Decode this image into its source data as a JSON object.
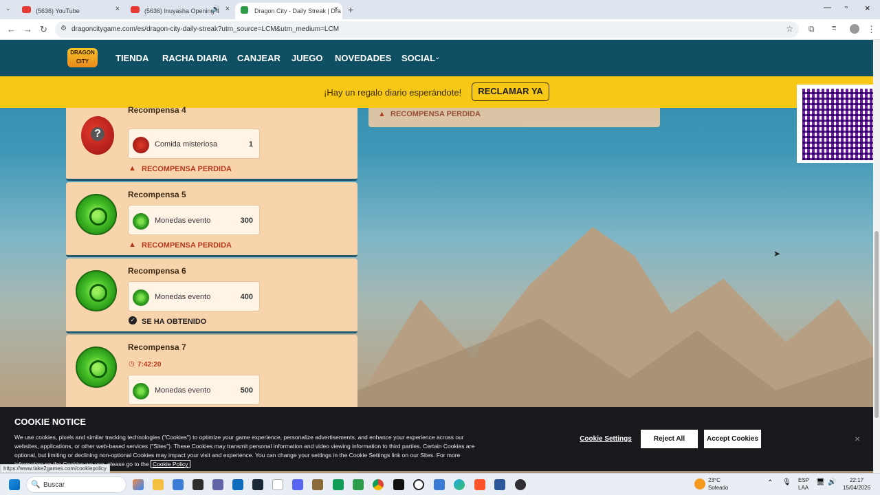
{
  "browser": {
    "tabs": [
      {
        "title": "(5636) YouTube"
      },
      {
        "title": "(5636) Inuyasha Opening 4"
      },
      {
        "title": "Dragon City - Daily Streak | Dra"
      }
    ],
    "url": "dragoncitygame.com/es/dragon-city-daily-streak?utm_source=LCM&utm_medium=LCM",
    "new_tab": "+"
  },
  "nav": {
    "logo": "DRAGON CITY",
    "items": [
      "TIENDA",
      "RACHA DIARIA",
      "CANJEAR",
      "JUEGO",
      "NOVEDADES",
      "SOCIAL"
    ]
  },
  "banner": {
    "message": "¡Hay un regalo diario esperándote!",
    "button": "RECLAMAR YA"
  },
  "rewards": [
    {
      "title": "Recompensa 4",
      "item": "Comida misteriosa",
      "qty": "1",
      "status": "RECOMPENSA PERDIDA"
    },
    {
      "title": "Recompensa 5",
      "item": "Monedas evento",
      "qty": "300",
      "status": "RECOMPENSA PERDIDA"
    },
    {
      "title": "Recompensa 6",
      "item": "Monedas evento",
      "qty": "400",
      "status": "SE HA OBTENIDO"
    },
    {
      "title": "Recompensa 7",
      "timer": "7:42:20",
      "item": "Monedas evento",
      "qty": "500"
    }
  ],
  "right_status": "RECOMPENSA PERDIDA",
  "cookie": {
    "title": "COOKIE NOTICE",
    "text": "We use cookies, pixels and similar tracking technologies (\"Cookies\") to optimize your game experience, personalize advertisements, and enhance your experience across our websites, applications, or other web-based services (\"Sites\"). These Cookies may transmit personal information and video viewing information to third parties. Certain Cookies are optional, but limiting or declining non-optional Cookies may impact your visit and experience. You can change your settings in the Cookie Settings link on our Sites. For more information on the Cookies we use, please go to the",
    "policy_link": "Cookie Policy",
    "settings": "Cookie Settings",
    "reject": "Reject All",
    "accept": "Accept Cookies",
    "close": "×"
  },
  "status_url": "https://www.take2games.com/cookiepolicy",
  "taskbar": {
    "search": "Buscar",
    "weather_temp": "23°C",
    "weather_desc": "Soleado",
    "lang1": "ESP",
    "lang2": "LAA",
    "time": "22:17",
    "date": "15/04/2026"
  },
  "colors": {
    "nav": "#0e4f63",
    "banner": "#f7c815",
    "card": "#f8d4ad",
    "lost": "#b53a1a"
  }
}
